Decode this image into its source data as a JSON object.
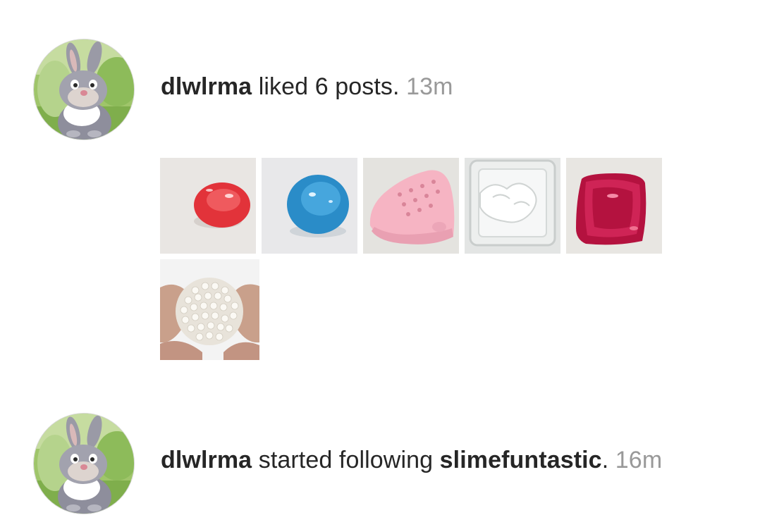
{
  "activities": [
    {
      "username": "dlwlrma",
      "action": "liked 6 posts.",
      "time": "13m",
      "avatar_icon": "bunny-avatar-icon",
      "posts": [
        {
          "icon": "red-slime-icon",
          "color": "#e8403f"
        },
        {
          "icon": "blue-slime-icon",
          "color": "#2e8fc9"
        },
        {
          "icon": "pink-slime-icon",
          "color": "#f4b3c1"
        },
        {
          "icon": "clear-slime-icon",
          "color": "#e3e6e4"
        },
        {
          "icon": "magenta-slime-icon",
          "color": "#c4184a"
        },
        {
          "icon": "pearl-slime-ball-icon",
          "color": "#f1eee8"
        }
      ]
    },
    {
      "username": "dlwlrma",
      "action": "started following",
      "target": "slimefuntastic",
      "punct": ".",
      "time": "16m",
      "avatar_icon": "bunny-avatar-icon"
    }
  ]
}
